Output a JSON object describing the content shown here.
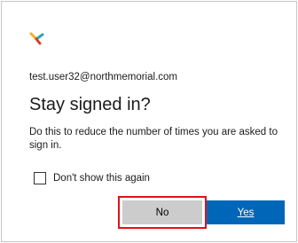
{
  "account": {
    "email": "test.user32@northmemorial.com"
  },
  "dialog": {
    "title": "Stay signed in?",
    "description": "Do this to reduce the number of times you are asked to sign in.",
    "checkbox_label": "Don't show this again",
    "checkbox_checked": false
  },
  "buttons": {
    "no_label": "No",
    "yes_label": "Yes"
  },
  "colors": {
    "primary_button": "#0067b8",
    "secondary_button": "#cccccc",
    "highlight": "#e0121a",
    "logo_yellow": "#f2b21b",
    "logo_teal": "#2aa8b5",
    "logo_red": "#d83b2a"
  },
  "icons": {
    "logo": "north-memorial-logo-icon"
  }
}
